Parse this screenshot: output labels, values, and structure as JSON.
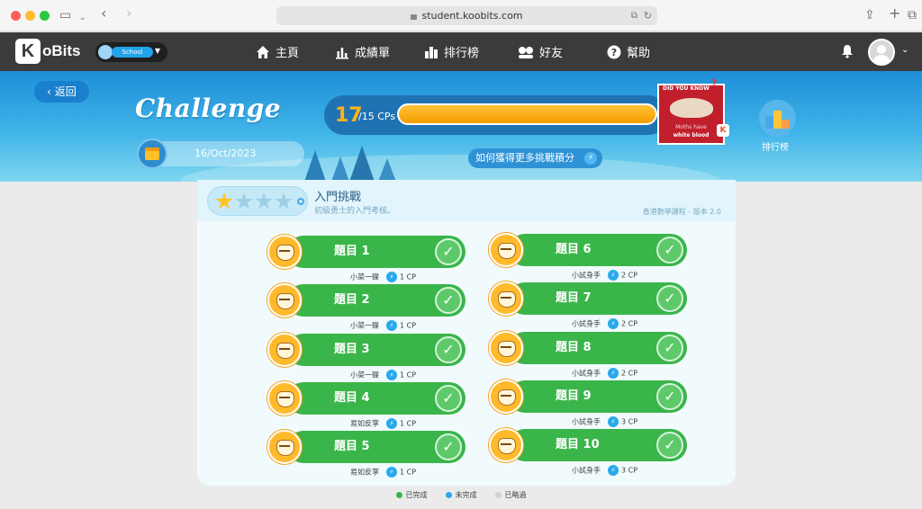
{
  "browser": {
    "url": "student.koobits.com"
  },
  "nav": {
    "logo": "oBits",
    "logo_letter": "K",
    "school_label": "School",
    "items": [
      {
        "label": "主頁",
        "icon": "home-icon"
      },
      {
        "label": "成績單",
        "icon": "bar-chart-icon"
      },
      {
        "label": "排行榜",
        "icon": "leaderboard-icon"
      },
      {
        "label": "好友",
        "icon": "friends-icon"
      },
      {
        "label": "幫助",
        "icon": "help-icon"
      }
    ]
  },
  "banner": {
    "back": "返回",
    "title": "Challenge",
    "date": "16/Oct/2023",
    "cp_current": "17",
    "cp_total": "/15 CPs",
    "cp_fill": 1.0,
    "how_label": "如何獲得更多挑戰積分",
    "card_header": "DID YOU KNOW",
    "card_line1": "Moths have",
    "card_line2": "white blood",
    "rank_label": "排行榜"
  },
  "panel": {
    "title": "入門挑戰",
    "subtitle": "初級勇士的入門考核。",
    "curriculum": "香港數學課程 - 版本 2.0",
    "stars_on": 1,
    "stars_total": 4,
    "questions": [
      {
        "label": "題目 1",
        "difficulty": "小菜一碟",
        "cp": "1 CP"
      },
      {
        "label": "題目 2",
        "difficulty": "小菜一碟",
        "cp": "1 CP"
      },
      {
        "label": "題目 3",
        "difficulty": "小菜一碟",
        "cp": "1 CP"
      },
      {
        "label": "題目 4",
        "difficulty": "易如反掌",
        "cp": "1 CP"
      },
      {
        "label": "題目 5",
        "difficulty": "易如反掌",
        "cp": "1 CP"
      },
      {
        "label": "題目 6",
        "difficulty": "小試身手",
        "cp": "2 CP"
      },
      {
        "label": "題目 7",
        "difficulty": "小試身手",
        "cp": "2 CP"
      },
      {
        "label": "題目 8",
        "difficulty": "小試身手",
        "cp": "2 CP"
      },
      {
        "label": "題目 9",
        "difficulty": "小試身手",
        "cp": "3 CP"
      },
      {
        "label": "題目 10",
        "difficulty": "小試身手",
        "cp": "3 CP"
      }
    ]
  },
  "legend": [
    {
      "label": "已完成",
      "color": "#3ab54a"
    },
    {
      "label": "未完成",
      "color": "#29a9ec"
    },
    {
      "label": "已略過",
      "color": "#d0d0d0"
    }
  ]
}
